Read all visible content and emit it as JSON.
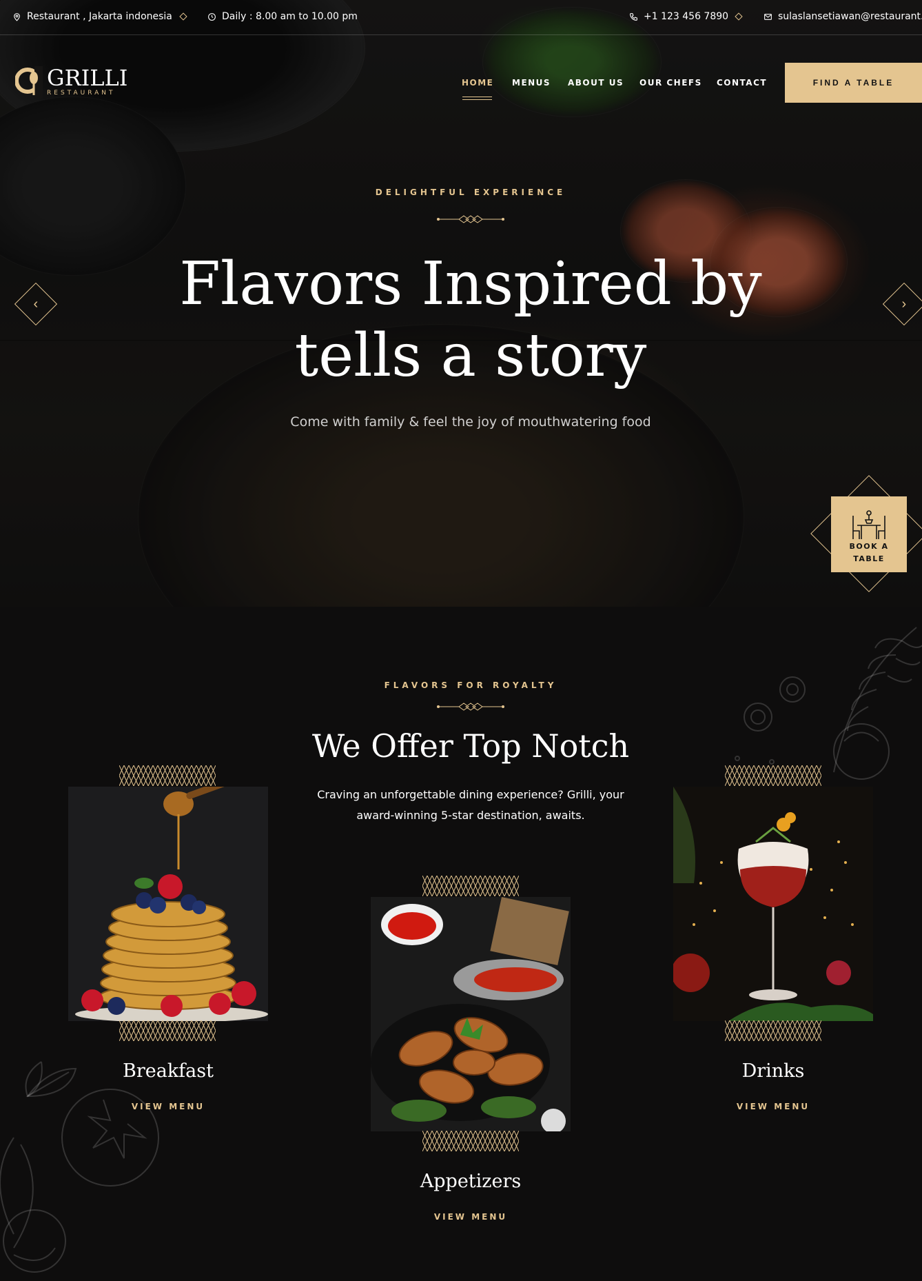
{
  "topbar": {
    "location": "Restaurant , Jakarta indonesia",
    "hours": "Daily : 8.00 am to 10.00 pm",
    "phone": "+1 123 456 7890",
    "email": "sulaslansetiawan@restaurant.co"
  },
  "brand": {
    "name": "GRILLI",
    "tagline": "RESTAURANT"
  },
  "nav": {
    "items": [
      {
        "label": "HOME",
        "active": true
      },
      {
        "label": "MENUS"
      },
      {
        "label": "ABOUT US"
      },
      {
        "label": "OUR CHEFS"
      },
      {
        "label": "CONTACT"
      }
    ],
    "cta": "FIND A TABLE"
  },
  "hero": {
    "label": "DELIGHTFUL EXPERIENCE",
    "title_line1": "Flavors Inspired by",
    "title_line2": "tells a story",
    "subtitle": "Come with family & feel the joy of mouthwatering food",
    "book_line1": "BOOK A",
    "book_line2": "TABLE"
  },
  "offer": {
    "label": "FLAVORS FOR ROYALTY",
    "title": "We Offer Top Notch",
    "text": "Craving an unforgettable dining experience? Grilli, your award-winning 5-star destination, awaits.",
    "cards": [
      {
        "title": "Breakfast",
        "link": "VIEW MENU"
      },
      {
        "title": "Appetizers",
        "link": "VIEW MENU"
      },
      {
        "title": "Drinks",
        "link": "VIEW MENU"
      }
    ]
  },
  "colors": {
    "accent": "#e4c590",
    "background": "#0e0d0d",
    "text": "#ffffff"
  },
  "icons": [
    "location-pin-icon",
    "clock-icon",
    "phone-icon",
    "mail-icon",
    "chevron-left-icon",
    "chevron-right-icon",
    "dining-table-icon"
  ]
}
